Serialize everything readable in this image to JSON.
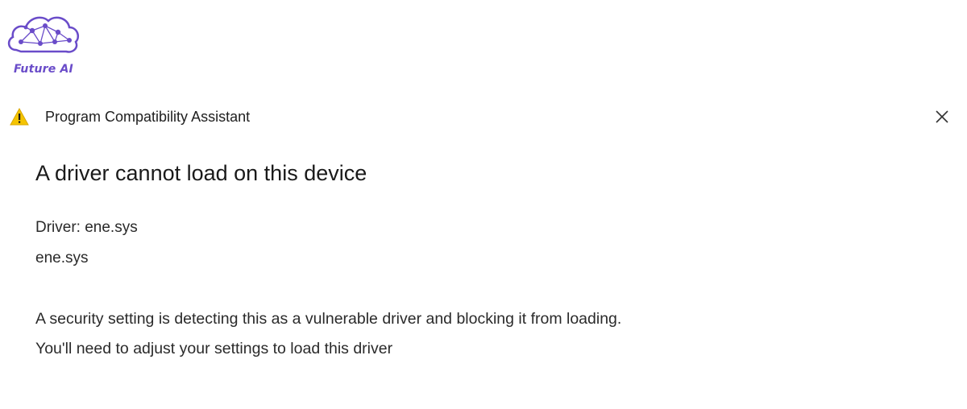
{
  "logo": {
    "text": "Future AI",
    "color": "#6a4cc9"
  },
  "window": {
    "title": "Program Compatibility Assistant",
    "title_icon": "warning-icon",
    "close_icon": "close-icon"
  },
  "dialog": {
    "heading": "A driver cannot load on this device",
    "driver_label": "Driver: ene.sys",
    "driver_file": "ene.sys",
    "message_line1": "A security setting is detecting this as a vulnerable driver and blocking it from loading.",
    "message_line2": "You'll need to adjust your settings to load this driver"
  },
  "colors": {
    "warning_yellow": "#f5c400",
    "background": "#ffffff",
    "text": "#1a1a1a"
  }
}
